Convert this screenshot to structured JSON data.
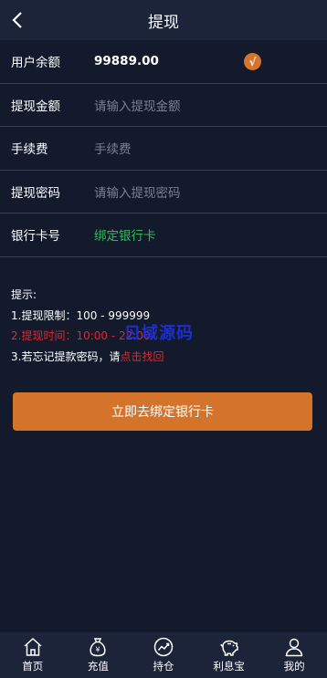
{
  "header": {
    "title": "提现",
    "back_icon": "chevron-left-icon"
  },
  "form": {
    "balance": {
      "label": "用户余额",
      "value": "99889.00",
      "check_glyph": "√"
    },
    "amount": {
      "label": "提现金额",
      "placeholder": "请输入提现金额"
    },
    "fee": {
      "label": "手续费",
      "placeholder": "手续费"
    },
    "password": {
      "label": "提现密码",
      "placeholder": "请输入提现密码"
    },
    "bank": {
      "label": "银行卡号",
      "link": "绑定银行卡"
    }
  },
  "tips": {
    "title": "提示:",
    "line1": "1.提现限制：100 - 999999",
    "line2": "2.提现时间：10:00 - 22:00",
    "line3_prefix": "3.若忘记提款密码，请",
    "line3_link": "点击找回"
  },
  "watermark": "ㄖ域源码",
  "submit_label": "立即去绑定银行卡",
  "tabbar": [
    {
      "label": "首页",
      "icon": "home-icon"
    },
    {
      "label": "充值",
      "icon": "money-bag-icon"
    },
    {
      "label": "持仓",
      "icon": "chart-icon"
    },
    {
      "label": "利息宝",
      "icon": "piggy-bank-icon"
    },
    {
      "label": "我的",
      "icon": "user-icon"
    }
  ],
  "colors": {
    "background": "#121a2b",
    "header": "#1b2438",
    "accent": "#d4742a",
    "link_green": "#2dbb55",
    "warning_red": "#e5262b"
  }
}
